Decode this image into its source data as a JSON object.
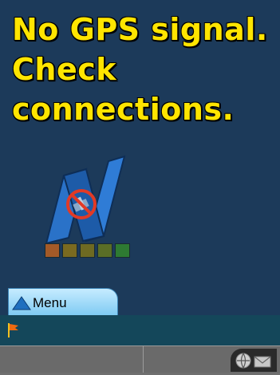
{
  "status": {
    "lines": [
      "No GPS signal.",
      "Check",
      "connections."
    ]
  },
  "menu": {
    "label": "Menu"
  },
  "icons": {
    "logo": "gps-no-signal-logo",
    "flag": "flag-icon",
    "tray_globe": "globe-icon",
    "tray_mail": "mail-icon"
  },
  "signal_strength": {
    "bars_lit": 0,
    "bar_colors": [
      "#a35a28",
      "#7a6a20",
      "#6e6a22",
      "#5a6e26",
      "#2e7a32"
    ]
  },
  "colors": {
    "background": "#1c3a5a",
    "message": "#ffe500",
    "status_strip": "#14475a",
    "softkey_bar": "#6a6a6a",
    "menu_tab": "#8fd2f5"
  }
}
